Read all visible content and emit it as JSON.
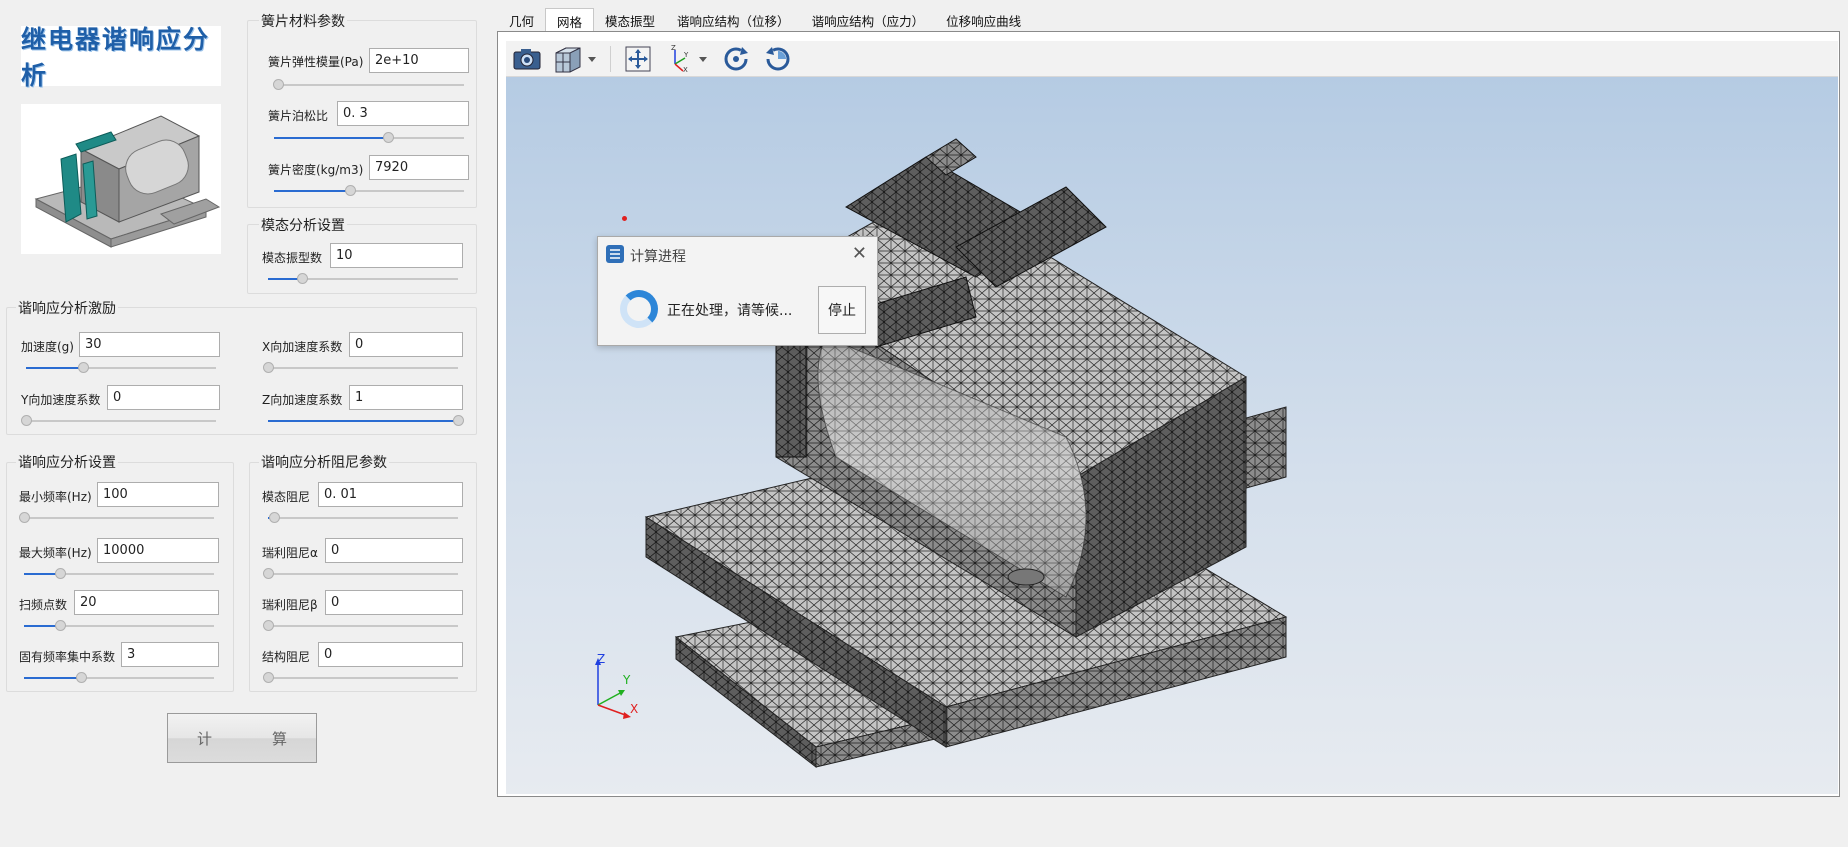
{
  "logo_text": "继电器谐响应分析",
  "material": {
    "title": "簧片材料参数",
    "fields": [
      {
        "label": "簧片弹性模量(Pa)",
        "value": "2e+10",
        "slider": 0.02
      },
      {
        "label": "簧片泊松比",
        "value": "0. 3",
        "slider": 0.6
      },
      {
        "label": "簧片密度(kg/m3)",
        "value": "7920",
        "slider": 0.4
      }
    ]
  },
  "modal": {
    "title": "模态分析设置",
    "fields": [
      {
        "label": "模态振型数",
        "value": "10",
        "slider": 0.18
      }
    ]
  },
  "excitation": {
    "title": "谐响应分析激励",
    "fields": [
      {
        "label": "加速度(g)",
        "value": "30",
        "slider": 0.3
      },
      {
        "label": "X向加速度系数",
        "value": "0",
        "slider": 0.0
      },
      {
        "label": "Y向加速度系数",
        "value": "0",
        "slider": 0.0
      },
      {
        "label": "Z向加速度系数",
        "value": "1",
        "slider": 1.0
      }
    ]
  },
  "analysis": {
    "title": "谐响应分析设置",
    "fields": [
      {
        "label": "最小频率(Hz)",
        "value": "100",
        "slider": 0.0
      },
      {
        "label": "最大频率(Hz)",
        "value": "10000",
        "slider": 0.19
      },
      {
        "label": "扫频点数",
        "value": "20",
        "slider": 0.19
      },
      {
        "label": "固有频率集中系数",
        "value": "3",
        "slider": 0.3
      }
    ]
  },
  "damping": {
    "title": "谐响应分析阻尼参数",
    "fields": [
      {
        "label": "模态阻尼",
        "value": "0. 01",
        "slider": 0.03
      },
      {
        "label": "瑞利阻尼α",
        "value": "0",
        "slider": 0.0
      },
      {
        "label": "瑞利阻尼β",
        "value": "0",
        "slider": 0.0
      },
      {
        "label": "结构阻尼",
        "value": "0",
        "slider": 0.0
      }
    ]
  },
  "compute_button": {
    "part1": "计",
    "part2": "算"
  },
  "tabs": [
    {
      "label": "几何",
      "active": false
    },
    {
      "label": "网格",
      "active": true
    },
    {
      "label": "模态振型",
      "active": false
    },
    {
      "label": "谐响应结构（位移）",
      "active": false
    },
    {
      "label": "谐响应结构（应力）",
      "active": false
    },
    {
      "label": "位移响应曲线",
      "active": false
    }
  ],
  "toolbar_icons": [
    "camera-icon",
    "view-cube-icon",
    "fit-view-icon",
    "axes-icon",
    "rotate-cw-icon",
    "rotate-ccw-icon"
  ],
  "axes": {
    "z": "Z",
    "y": "Y",
    "x": "X"
  },
  "dialog": {
    "title": "计算进程",
    "message": "正在处理，请等候...",
    "stop_label": "停止"
  },
  "colors": {
    "accent": "#2a6bd1",
    "x_axis": "#e02020",
    "y_axis": "#20b020",
    "z_axis": "#2040e0"
  }
}
